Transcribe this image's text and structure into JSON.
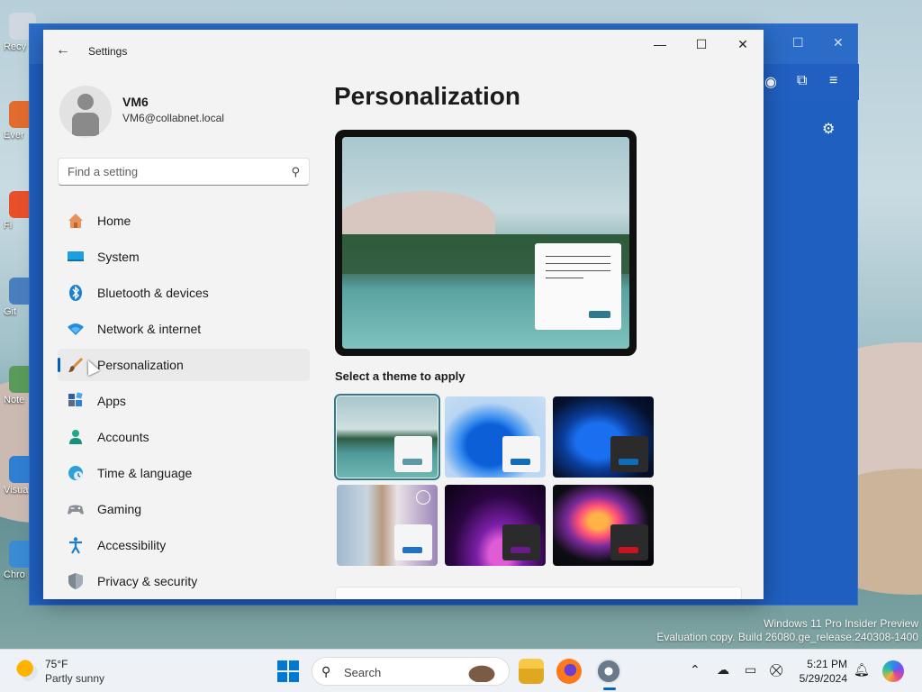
{
  "window": {
    "title": "Settings"
  },
  "user": {
    "name": "VM6",
    "email": "VM6@collabnet.local"
  },
  "search": {
    "placeholder": "Find a setting"
  },
  "nav": {
    "items": [
      {
        "label": "Home",
        "icon": "home-icon"
      },
      {
        "label": "System",
        "icon": "system-icon"
      },
      {
        "label": "Bluetooth & devices",
        "icon": "bluetooth-icon"
      },
      {
        "label": "Network & internet",
        "icon": "wifi-icon"
      },
      {
        "label": "Personalization",
        "icon": "brush-icon",
        "selected": true
      },
      {
        "label": "Apps",
        "icon": "apps-icon"
      },
      {
        "label": "Accounts",
        "icon": "person-icon"
      },
      {
        "label": "Time & language",
        "icon": "globe-clock-icon"
      },
      {
        "label": "Gaming",
        "icon": "controller-icon"
      },
      {
        "label": "Accessibility",
        "icon": "accessibility-icon"
      },
      {
        "label": "Privacy & security",
        "icon": "shield-icon"
      }
    ]
  },
  "content": {
    "title": "Personalization",
    "theme_heading": "Select a theme to apply",
    "themes": [
      {
        "name": "theme-lake",
        "accent": "#5a9aa6",
        "selected": true
      },
      {
        "name": "theme-bloom-light",
        "accent": "#0f6cbd"
      },
      {
        "name": "theme-bloom-dark",
        "accent": "#0f6cbd"
      },
      {
        "name": "theme-spotlight",
        "accent": "#1d73c4"
      },
      {
        "name": "theme-glow",
        "accent": "#6b1a8a"
      },
      {
        "name": "theme-captured-motion",
        "accent": "#c81420"
      }
    ]
  },
  "watermark": {
    "line1": "Windows 11 Pro Insider Preview",
    "line2": "Evaluation copy. Build 26080.ge_release.240308-1400"
  },
  "taskbar": {
    "weather_temp": "75°F",
    "weather_desc": "Partly sunny",
    "search_label": "Search",
    "time": "5:21 PM",
    "date": "5/29/2024"
  },
  "desktop_icons": [
    "Recy",
    "Ever",
    "Fi",
    "Git",
    "Note",
    "Visua\nC",
    "Chro"
  ]
}
